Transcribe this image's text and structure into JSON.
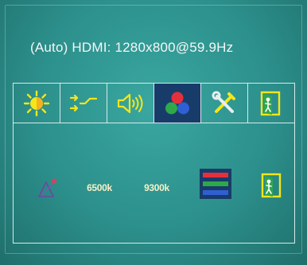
{
  "osd": {
    "resolution_text": "(Auto) HDMI: 1280x800@59.9Hz"
  },
  "tabs": [
    {
      "icon": "brightness-icon",
      "label": ""
    },
    {
      "icon": "input-switch-icon",
      "label": ""
    },
    {
      "icon": "volume-icon",
      "label": ""
    },
    {
      "icon": "color-icon",
      "label": "",
      "selected": true
    },
    {
      "icon": "tools-icon",
      "label": ""
    },
    {
      "icon": "exit-icon",
      "label": ""
    }
  ],
  "color_panel": {
    "options": [
      {
        "icon": "auto-color-icon"
      },
      {
        "label": "6500k"
      },
      {
        "label": "9300k"
      },
      {
        "icon": "user-color-icon"
      },
      {
        "icon": "exit-icon"
      }
    ]
  },
  "colors": {
    "background": "#2c8f8b",
    "selected_tab": "#183c6a",
    "border": "#d7ebe9",
    "text": "#f3f7f6"
  }
}
